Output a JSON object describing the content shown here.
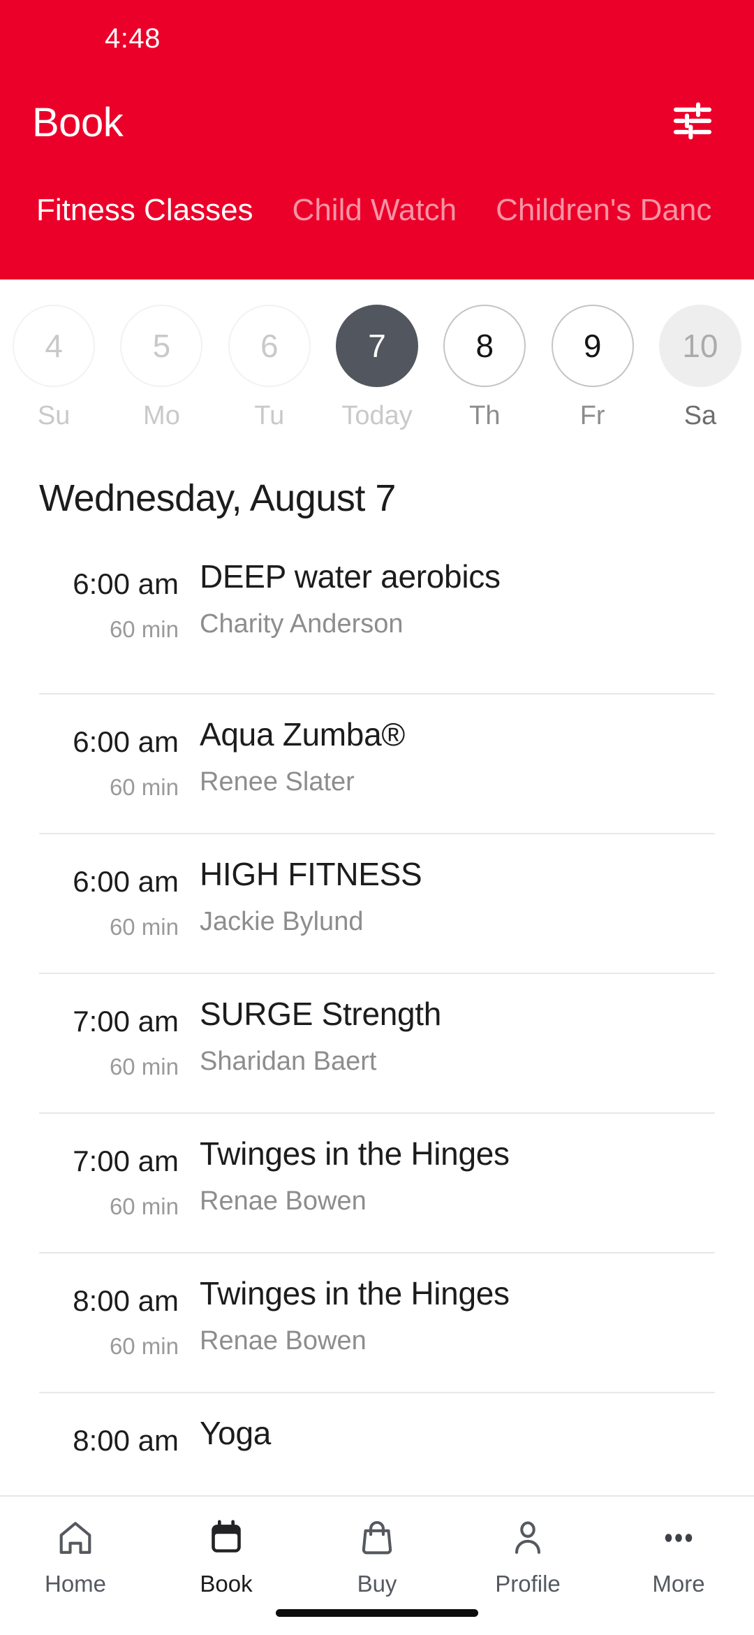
{
  "theme": {
    "brand_red": "#EB0029",
    "selected_day_bg": "#52565E",
    "text_primary": "#1c1c1c",
    "text_muted": "#8d8d8d"
  },
  "status_bar": {
    "time": "4:48"
  },
  "header": {
    "title": "Book",
    "filter_icon": "tune-icon",
    "tabs": [
      {
        "label": "Fitness Classes",
        "active": true
      },
      {
        "label": "Child Watch",
        "active": false
      },
      {
        "label": "Children's Danc",
        "active": false
      }
    ]
  },
  "date_strip": [
    {
      "day": "4",
      "weekday": "Su",
      "state": "past"
    },
    {
      "day": "5",
      "weekday": "Mo",
      "state": "past"
    },
    {
      "day": "6",
      "weekday": "Tu",
      "state": "past"
    },
    {
      "day": "7",
      "weekday": "Today",
      "state": "today"
    },
    {
      "day": "8",
      "weekday": "Th",
      "state": "future"
    },
    {
      "day": "9",
      "weekday": "Fr",
      "state": "future"
    },
    {
      "day": "10",
      "weekday": "Sa",
      "state": "weekend"
    }
  ],
  "schedule": {
    "date_heading": "Wednesday, August 7",
    "classes": [
      {
        "time": "6:00 am",
        "duration": "60 min",
        "name": "DEEP water aerobics",
        "instructor": "Charity Anderson"
      },
      {
        "time": "6:00 am",
        "duration": "60 min",
        "name": "Aqua Zumba®",
        "instructor": "Renee Slater"
      },
      {
        "time": "6:00 am",
        "duration": "60 min",
        "name": "HIGH FITNESS",
        "instructor": "Jackie Bylund"
      },
      {
        "time": "7:00 am",
        "duration": "60 min",
        "name": "SURGE Strength",
        "instructor": "Sharidan Baert"
      },
      {
        "time": "7:00 am",
        "duration": "60 min",
        "name": "Twinges in the Hinges",
        "instructor": "Renae Bowen"
      },
      {
        "time": "8:00 am",
        "duration": "60 min",
        "name": "Twinges in the Hinges",
        "instructor": "Renae Bowen"
      },
      {
        "time": "8:00 am",
        "duration": "",
        "name": "Yoga",
        "instructor": ""
      }
    ]
  },
  "bottom_nav": [
    {
      "label": "Home",
      "icon": "home-icon",
      "active": false
    },
    {
      "label": "Book",
      "icon": "calendar-icon",
      "active": true
    },
    {
      "label": "Buy",
      "icon": "bag-icon",
      "active": false
    },
    {
      "label": "Profile",
      "icon": "person-icon",
      "active": false
    },
    {
      "label": "More",
      "icon": "ellipsis-icon",
      "active": false
    }
  ]
}
